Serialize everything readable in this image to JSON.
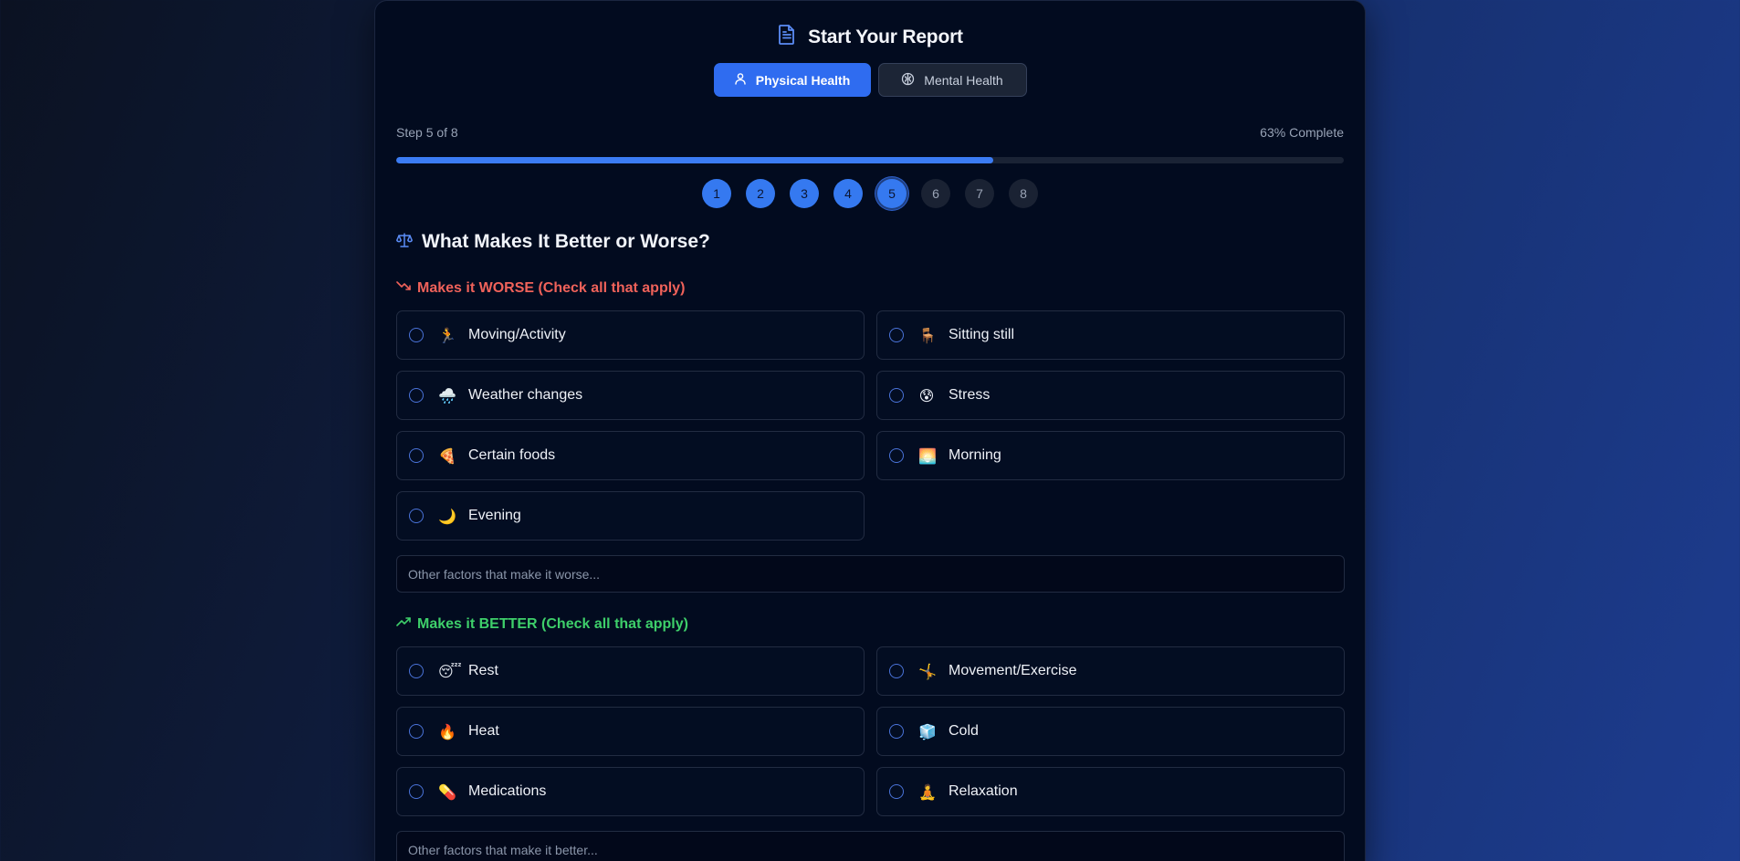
{
  "header": {
    "title": "Start Your Report",
    "icon": "document-icon"
  },
  "tabs": [
    {
      "label": "Physical Health",
      "icon": "user-icon",
      "active": true
    },
    {
      "label": "Mental Health",
      "icon": "brain-icon",
      "active": false
    }
  ],
  "progress": {
    "step_text": "Step 5 of 8",
    "percent_text": "63% Complete",
    "fraction": 0.63
  },
  "steps": [
    "1",
    "2",
    "3",
    "4",
    "5",
    "6",
    "7",
    "8"
  ],
  "current_step": 5,
  "section": {
    "title": "What Makes It Better or Worse?",
    "icon": "scale-icon"
  },
  "worse": {
    "label": "Makes it WORSE (Check all that apply)",
    "icon": "trending-down-icon",
    "options": [
      {
        "emoji": "🏃",
        "label": "Moving/Activity"
      },
      {
        "emoji": "🪑",
        "label": "Sitting still"
      },
      {
        "emoji": "🌧️",
        "label": "Weather changes"
      },
      {
        "emoji": "😰",
        "label": "Stress"
      },
      {
        "emoji": "🍕",
        "label": "Certain foods"
      },
      {
        "emoji": "🌅",
        "label": "Morning"
      },
      {
        "emoji": "🌙",
        "label": "Evening"
      }
    ],
    "other_placeholder": "Other factors that make it worse..."
  },
  "better": {
    "label": "Makes it BETTER (Check all that apply)",
    "icon": "trending-up-icon",
    "options": [
      {
        "emoji": "😴",
        "label": "Rest"
      },
      {
        "emoji": "🤸",
        "label": "Movement/Exercise"
      },
      {
        "emoji": "🔥",
        "label": "Heat"
      },
      {
        "emoji": "🧊",
        "label": "Cold"
      },
      {
        "emoji": "💊",
        "label": "Medications"
      },
      {
        "emoji": "🧘",
        "label": "Relaxation"
      }
    ],
    "other_placeholder": "Other factors that make it better..."
  },
  "colors": {
    "accent": "#3b7cf4",
    "worse": "#f0625a",
    "better": "#3ecf6a",
    "panel": "#020b1f"
  }
}
